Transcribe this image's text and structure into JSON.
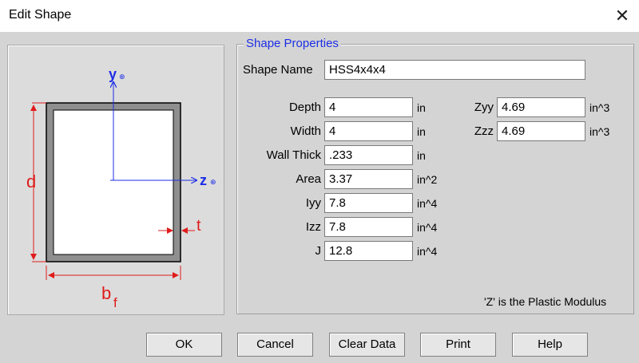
{
  "window": {
    "title": "Edit Shape",
    "close_glyph": "✕"
  },
  "diagram": {
    "y_axis": "y",
    "z_axis": "z",
    "depth_symbol": "d",
    "thickness_symbol": "t",
    "width_symbol": "b",
    "width_subscript": "f"
  },
  "group": {
    "legend": "Shape Properties"
  },
  "shape_name": {
    "label": "Shape Name",
    "value": "HSS4x4x4"
  },
  "properties": [
    {
      "label": "Depth",
      "value": "4",
      "unit": "in"
    },
    {
      "label": "Width",
      "value": "4",
      "unit": "in"
    },
    {
      "label": "Wall Thick",
      "value": ".233",
      "unit": "in"
    },
    {
      "label": "Area",
      "value": "3.37",
      "unit": "in^2"
    },
    {
      "label": "Iyy",
      "value": "7.8",
      "unit": "in^4"
    },
    {
      "label": "Izz",
      "value": "7.8",
      "unit": "in^4"
    },
    {
      "label": "J",
      "value": "12.8",
      "unit": "in^4"
    }
  ],
  "plastic": [
    {
      "label": "Zyy",
      "value": "4.69",
      "unit": "in^3"
    },
    {
      "label": "Zzz",
      "value": "4.69",
      "unit": "in^3"
    }
  ],
  "note": "'Z' is the Plastic Modulus",
  "buttons": {
    "ok": "OK",
    "cancel": "Cancel",
    "clear": "Clear Data",
    "print": "Print",
    "help": "Help"
  },
  "colors": {
    "accent": "#1d2ee6",
    "dimension": "#e01b1b",
    "tube_fill": "#8f8f8f"
  }
}
